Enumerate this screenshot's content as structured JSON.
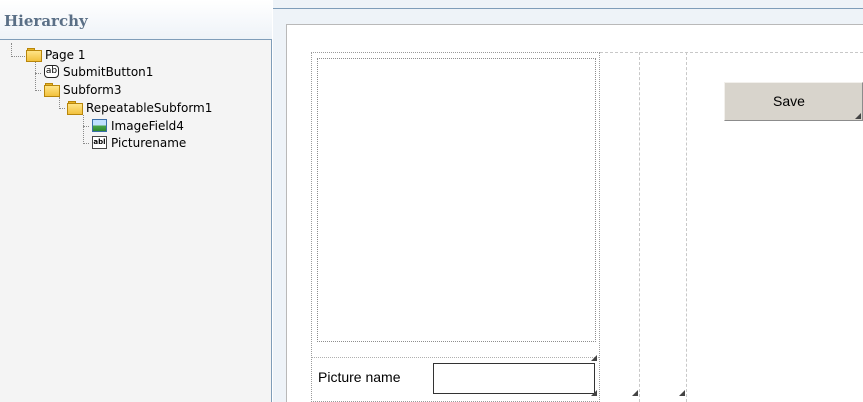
{
  "hierarchy": {
    "title": "Hierarchy",
    "nodes": [
      {
        "label": "Page 1",
        "icon": "folder-icon"
      },
      {
        "label": "SubmitButton1",
        "icon": "button-icon"
      },
      {
        "label": "Subform3",
        "icon": "folder-icon"
      },
      {
        "label": "RepeatableSubform1",
        "icon": "folder-icon"
      },
      {
        "label": "ImageField4",
        "icon": "image-field-icon"
      },
      {
        "label": "Picturename",
        "icon": "text-field-icon"
      }
    ]
  },
  "form": {
    "save_label": "Save",
    "picture_name_label": "Picture name",
    "picture_name_value": ""
  },
  "icons": {
    "button_icon_text": "ab",
    "text_field_icon_text": "abl"
  }
}
